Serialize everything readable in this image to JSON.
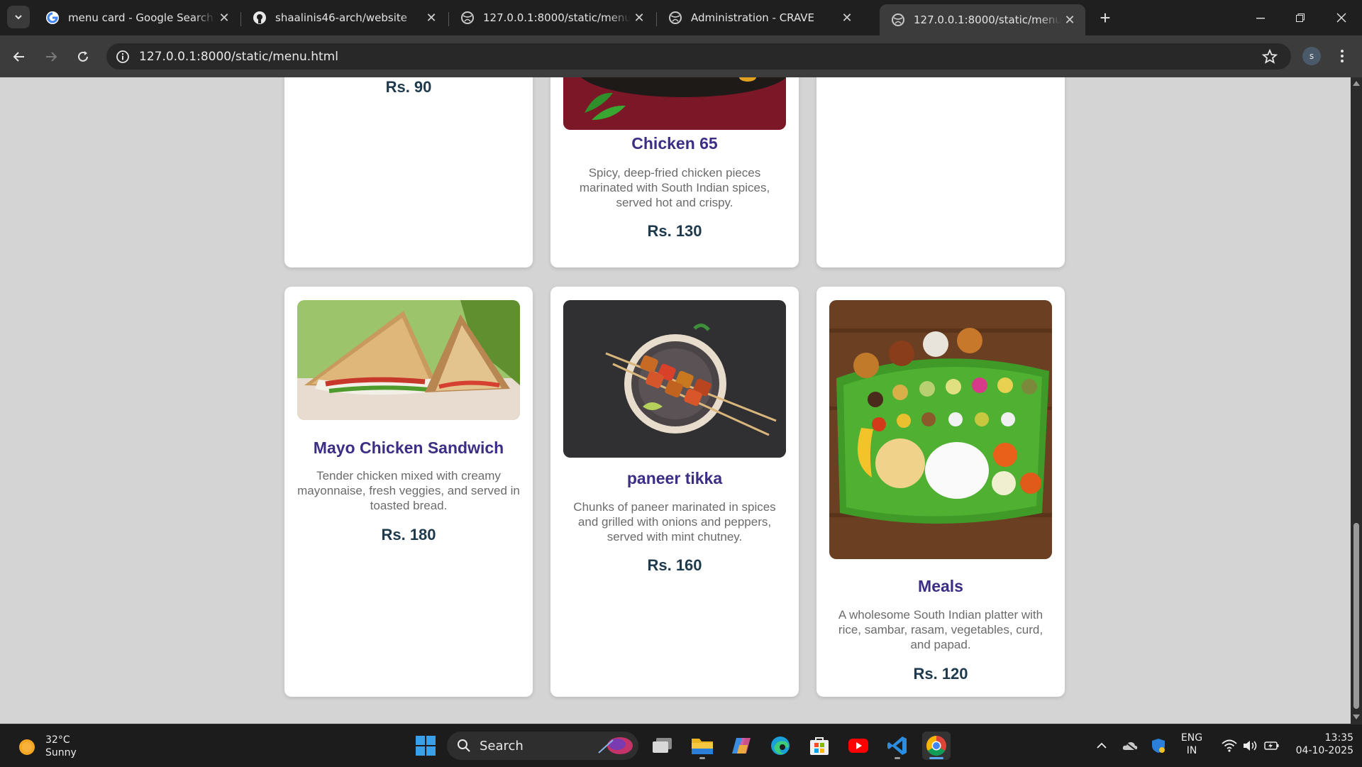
{
  "browser": {
    "tabs": [
      {
        "title": "menu card - Google Search",
        "icon": "google-icon"
      },
      {
        "title": "shaalinis46-arch/website",
        "icon": "github-icon"
      },
      {
        "title": "127.0.0.1:8000/static/menu.html",
        "icon": "globe-icon"
      },
      {
        "title": "Administration - CRAVE",
        "icon": "globe-icon"
      },
      {
        "title": "127.0.0.1:8000/static/menu.html",
        "icon": "globe-icon",
        "active": true
      }
    ],
    "url": "127.0.0.1:8000/static/menu.html",
    "profile_initial": "s"
  },
  "menu": {
    "top_row": [
      {
        "price": "Rs. 90"
      },
      {
        "name": "Chicken 65",
        "description": "Spicy, deep-fried chicken pieces marinated with South Indian spices, served hot and crispy.",
        "price": "Rs. 130"
      },
      {}
    ],
    "items": [
      {
        "name": "Mayo Chicken Sandwich",
        "description": "Tender chicken mixed with creamy mayonnaise, fresh veggies, and served in toasted bread.",
        "price": "Rs. 180"
      },
      {
        "name": "paneer tikka",
        "description": "Chunks of paneer marinated in spices and grilled with onions and peppers, served with mint chutney.",
        "price": "Rs. 160"
      },
      {
        "name": "Meals",
        "description": "A wholesome South Indian platter with rice, sambar, rasam, vegetables, curd, and papad.",
        "price": "Rs. 120"
      }
    ]
  },
  "colors": {
    "title": "#3d2e85",
    "price": "#1e3a4c",
    "desc": "#6b6b6b",
    "page_bg": "#d4d4d4"
  },
  "taskbar": {
    "weather_temp": "32°C",
    "weather_desc": "Sunny",
    "search_label": "Search",
    "lang_top": "ENG",
    "lang_bottom": "IN",
    "time": "13:35",
    "date": "04-10-2025"
  }
}
